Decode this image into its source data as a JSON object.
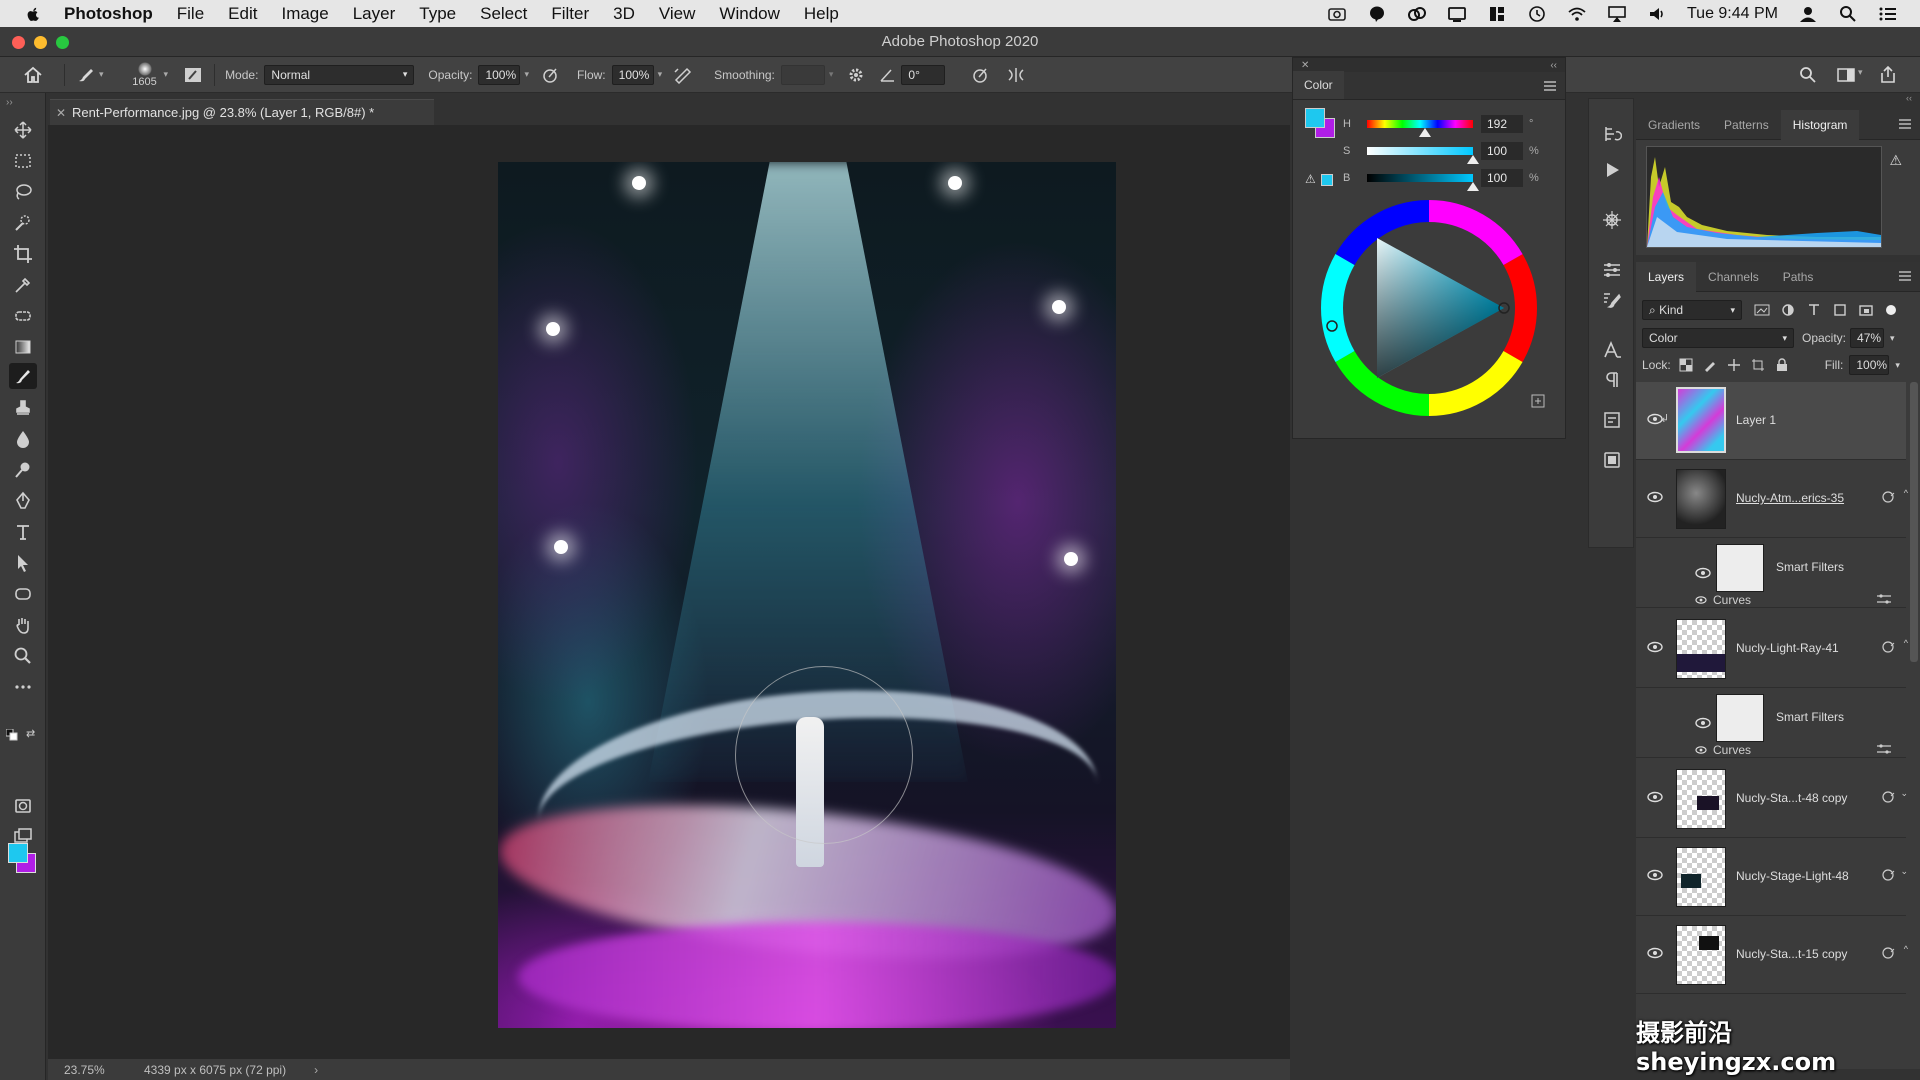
{
  "menubar": {
    "app": "Photoshop",
    "items": [
      "File",
      "Edit",
      "Image",
      "Layer",
      "Type",
      "Select",
      "Filter",
      "3D",
      "View",
      "Window",
      "Help"
    ],
    "clock": "Tue 9:44 PM"
  },
  "window": {
    "title": "Adobe Photoshop 2020"
  },
  "options": {
    "brush_size": "1605",
    "mode_label": "Mode:",
    "mode_value": "Normal",
    "opacity_label": "Opacity:",
    "opacity_value": "100%",
    "flow_label": "Flow:",
    "flow_value": "100%",
    "smoothing_label": "Smoothing:",
    "smoothing_value": "",
    "angle_value": "0°"
  },
  "document": {
    "tab_title": "Rent-Performance.jpg @ 23.8% (Layer 1, RGB/8#) *",
    "zoom": "23.75%",
    "dimensions": "4339 px x 6075 px (72 ppi)"
  },
  "color_panel": {
    "tab": "Color",
    "h_label": "H",
    "h_value": "192",
    "h_unit": "°",
    "s_label": "S",
    "s_value": "100",
    "s_unit": "%",
    "b_label": "B",
    "b_value": "100",
    "b_unit": "%",
    "foreground": "#1ec8ef",
    "background": "#b01ee6"
  },
  "top_panel": {
    "tabs": [
      "Gradients",
      "Patterns",
      "Histogram"
    ],
    "active": "Histogram"
  },
  "layers_panel": {
    "tabs": [
      "Layers",
      "Channels",
      "Paths"
    ],
    "active": "Layers",
    "filter_kind": "Kind",
    "blend_mode": "Color",
    "opacity_label": "Opacity:",
    "opacity": "47%",
    "lock_label": "Lock:",
    "fill_label": "Fill:",
    "fill": "100%",
    "layers": [
      {
        "name": "Layer 1",
        "selected": true
      },
      {
        "name": "Nucly-Atm...erics-35",
        "smart_filters": "Smart Filters",
        "filter": "Curves"
      },
      {
        "name": "Nucly-Light-Ray-41",
        "smart_filters": "Smart Filters",
        "filter": "Curves"
      },
      {
        "name": "Nucly-Sta...t-48 copy"
      },
      {
        "name": "Nucly-Stage-Light-48"
      },
      {
        "name": "Nucly-Sta...t-15 copy"
      }
    ]
  },
  "watermark": "摄影前沿sheyingzx.com"
}
